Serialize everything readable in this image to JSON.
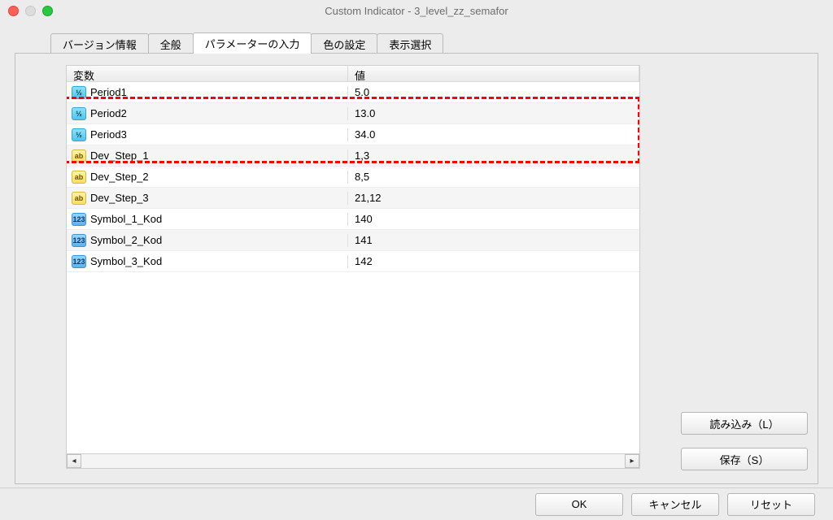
{
  "window": {
    "title": "Custom Indicator - 3_level_zz_semafor"
  },
  "tabs": {
    "items": [
      {
        "label": "バージョン情報"
      },
      {
        "label": "全般"
      },
      {
        "label": "パラメーターの入力"
      },
      {
        "label": "色の設定"
      },
      {
        "label": "表示選択"
      }
    ],
    "activeIndex": 2
  },
  "grid": {
    "headers": {
      "variable": "変数",
      "value": "値"
    },
    "rows": [
      {
        "type": "float",
        "icon": "½",
        "name": "Period1",
        "value": "5.0"
      },
      {
        "type": "float",
        "icon": "½",
        "name": "Period2",
        "value": "13.0"
      },
      {
        "type": "float",
        "icon": "½",
        "name": "Period3",
        "value": "34.0"
      },
      {
        "type": "str",
        "icon": "ab",
        "name": "Dev_Step_1",
        "value": "1,3"
      },
      {
        "type": "str",
        "icon": "ab",
        "name": "Dev_Step_2",
        "value": "8,5"
      },
      {
        "type": "str",
        "icon": "ab",
        "name": "Dev_Step_3",
        "value": "21,12"
      },
      {
        "type": "int",
        "icon": "123",
        "name": "Symbol_1_Kod",
        "value": "140"
      },
      {
        "type": "int",
        "icon": "123",
        "name": "Symbol_2_Kod",
        "value": "141"
      },
      {
        "type": "int",
        "icon": "123",
        "name": "Symbol_3_Kod",
        "value": "142"
      }
    ]
  },
  "buttons": {
    "load": "読み込み（L）",
    "save": "保存（S）",
    "ok": "OK",
    "cancel": "キャンセル",
    "reset": "リセット"
  }
}
